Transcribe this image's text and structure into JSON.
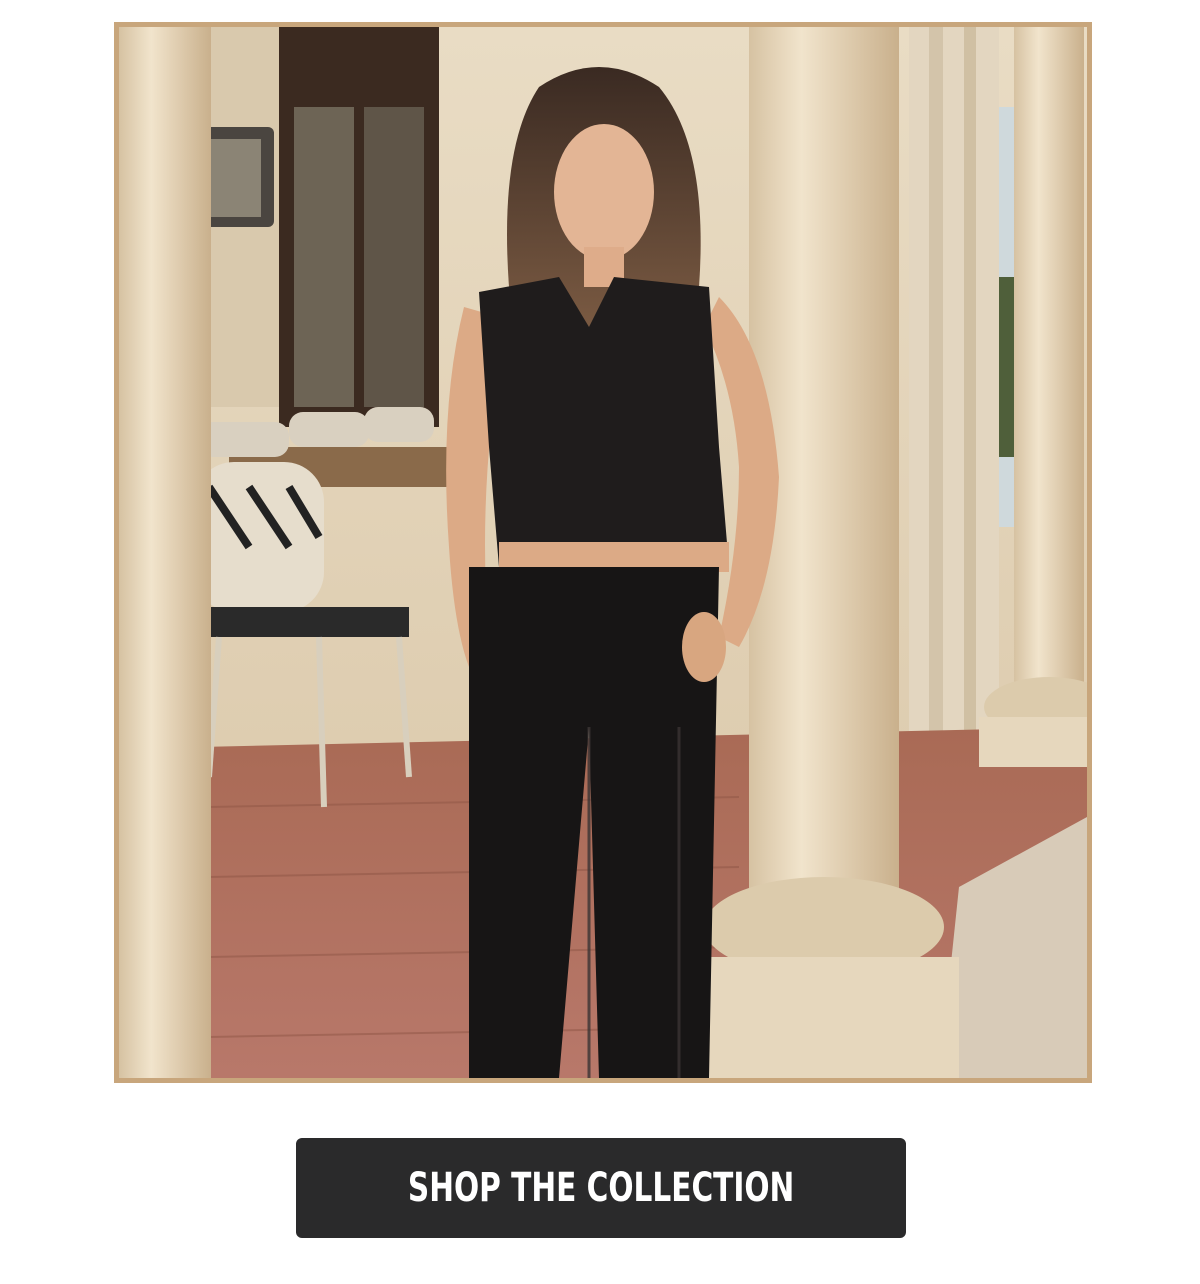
{
  "hero": {
    "image_subject": "model-in-black-eyelet-top-and-pants",
    "frame_color": "#c8a67c"
  },
  "cta": {
    "label": "SHOP THE COLLECTION",
    "background": "#2a2a2b",
    "text_color": "#ffffff"
  }
}
